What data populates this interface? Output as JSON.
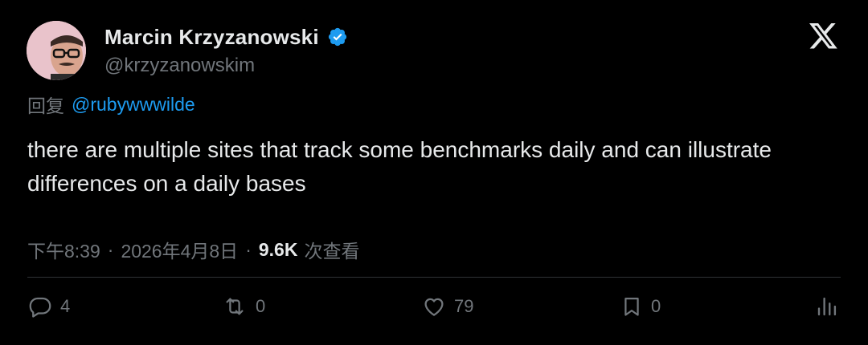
{
  "author": {
    "display_name": "Marcin Krzyzanowski",
    "handle": "@krzyzanowskim",
    "verified": true,
    "avatar": "avatar-photo"
  },
  "brand": {
    "logo": "x-logo-icon"
  },
  "reply_context": {
    "prefix": "回复",
    "mention": "@rubywwwilde"
  },
  "tweet": {
    "text": "there are multiple sites that track some benchmarks daily and can illustrate differences on a daily bases"
  },
  "meta": {
    "time": "下午8:39",
    "separator": "·",
    "date": "2026年4月8日",
    "views_count": "9.6K",
    "views_label": "次查看"
  },
  "actions": {
    "replies": "4",
    "retweets": "0",
    "likes": "79",
    "bookmarks": "0"
  },
  "colors": {
    "background": "#000000",
    "text_primary": "#e7e9ea",
    "text_secondary": "#71767b",
    "accent": "#1d9bf0",
    "divider": "#2f3336"
  }
}
